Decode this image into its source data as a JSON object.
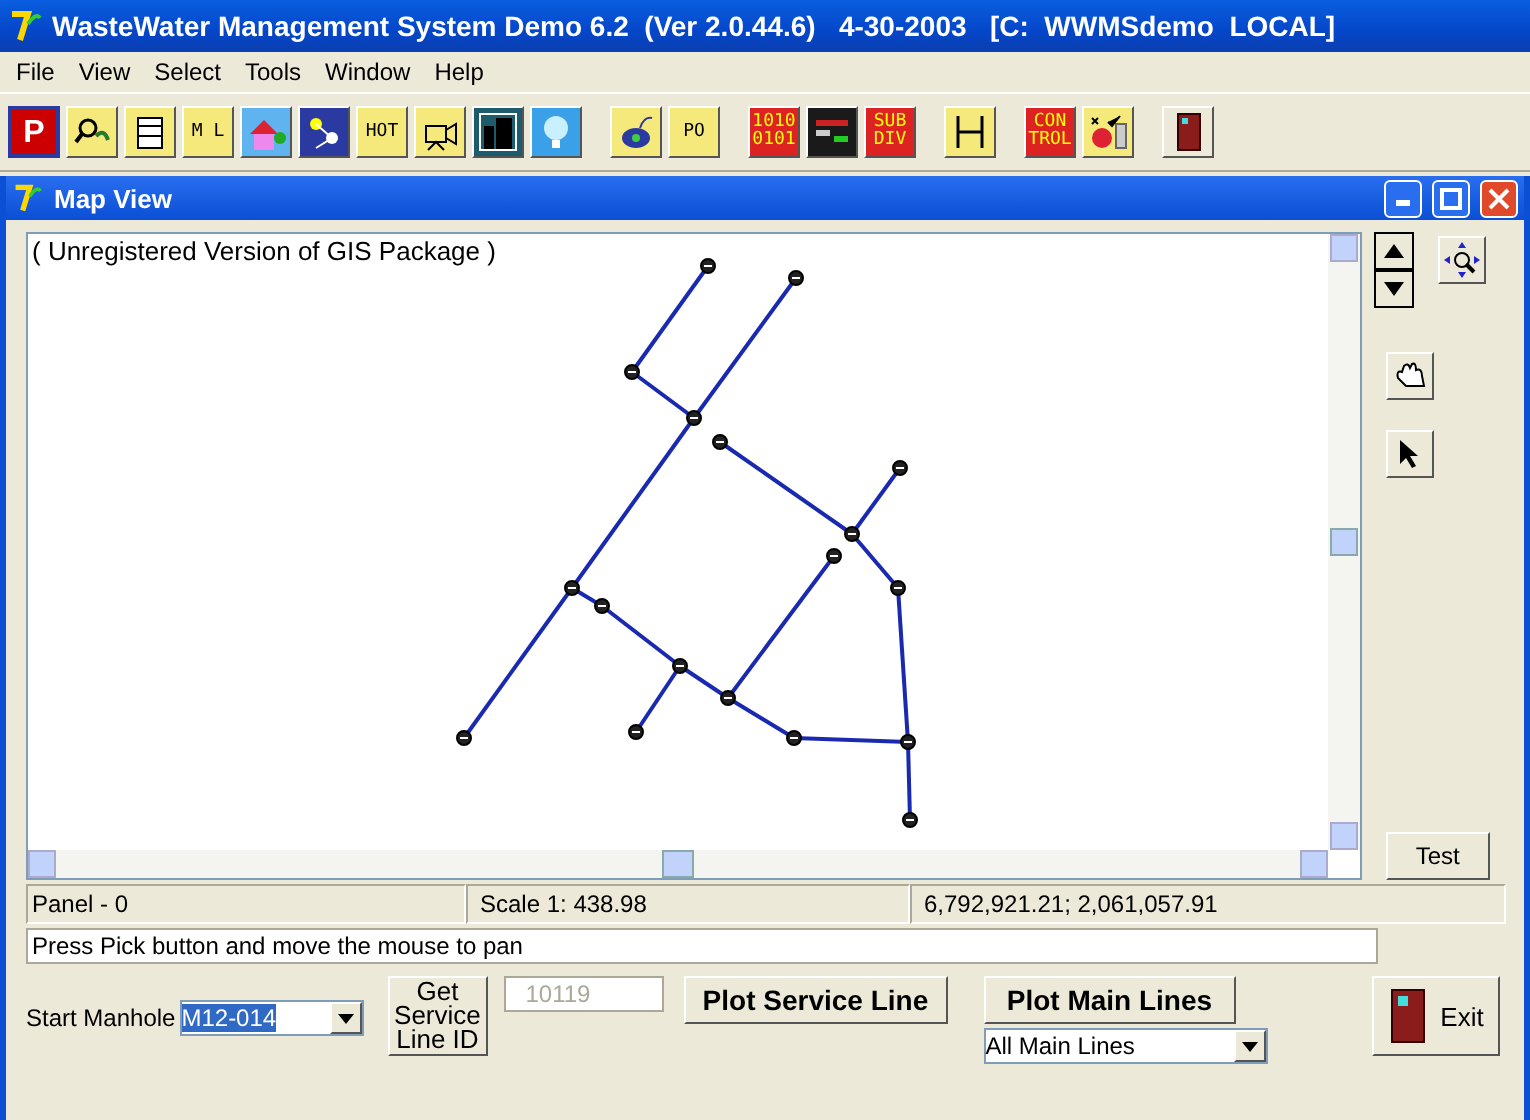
{
  "window": {
    "title": "WasteWater Management System Demo 6.2  (Ver 2.0.44.6)   4-30-2003   [C:  WWMSdemo  LOCAL]"
  },
  "menu": [
    "File",
    "View",
    "Select",
    "Tools",
    "Window",
    "Help"
  ],
  "toolbar": [
    [
      {
        "kind": "letter",
        "label": "P"
      },
      {
        "kind": "magnifier"
      },
      {
        "kind": "jar"
      },
      {
        "kind": "tag",
        "label": "M L"
      },
      {
        "kind": "house"
      },
      {
        "kind": "diagram"
      },
      {
        "kind": "tag",
        "label": "HOT"
      },
      {
        "kind": "camera"
      },
      {
        "kind": "building"
      },
      {
        "kind": "bulb"
      }
    ],
    [
      {
        "kind": "mouse"
      },
      {
        "kind": "tag",
        "label": "PO"
      }
    ],
    [
      {
        "kind": "tag",
        "label": "1010 0101"
      },
      {
        "kind": "monitor"
      },
      {
        "kind": "tag",
        "label": "SUB DIV"
      }
    ],
    [
      {
        "kind": "frame"
      }
    ],
    [
      {
        "kind": "tag",
        "label": "CON TROL"
      },
      {
        "kind": "checklist"
      }
    ],
    [
      {
        "kind": "door"
      }
    ]
  ],
  "child_window": {
    "title": "Map View"
  },
  "map": {
    "notice": "( Unregistered Version of GIS Package )"
  },
  "side_tools": {
    "test_button": "Test"
  },
  "status_bar": [
    "Panel - 0",
    "Scale 1: 438.98",
    "6,792,921.21; 2,061,057.91"
  ],
  "message": "Press Pick button and move the mouse to pan",
  "controls": {
    "start_manhole_label": "Start Manhole",
    "start_manhole_value": "M12-014",
    "get_button": "Get Service Line ID",
    "service_line_id": "10119",
    "plot_service_button": "Plot Service Line",
    "plot_main_button": "Plot Main Lines",
    "main_lines_value": "All Main Lines",
    "exit_button": "Exit"
  }
}
